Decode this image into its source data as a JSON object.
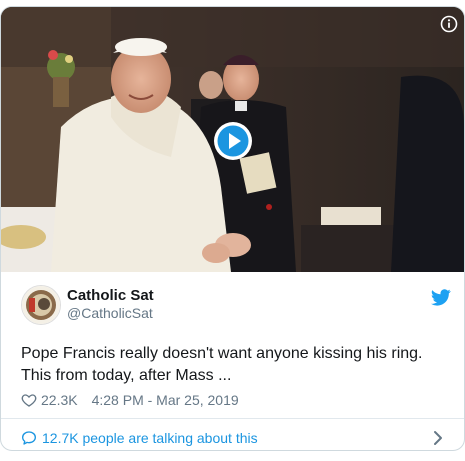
{
  "tweet": {
    "author_name": "Catholic Sat",
    "author_handle": "@CatholicSat",
    "text": "Pope Francis really doesn't want anyone kissing his ring. This from today, after Mass ...",
    "likes": "22.3K",
    "timestamp": "4:28 PM - Mar 25, 2019",
    "talking_text": "12.7K people are talking about this"
  },
  "icons": {
    "info": "info-icon",
    "play": "play-icon",
    "brand": "twitter-bird-icon",
    "like": "heart-icon",
    "reply": "speech-bubble-icon",
    "more": "chevron-right-icon"
  },
  "colors": {
    "accent": "#1b95e0",
    "text": "#14171a",
    "muted": "#657786",
    "border": "#cfd9de"
  }
}
